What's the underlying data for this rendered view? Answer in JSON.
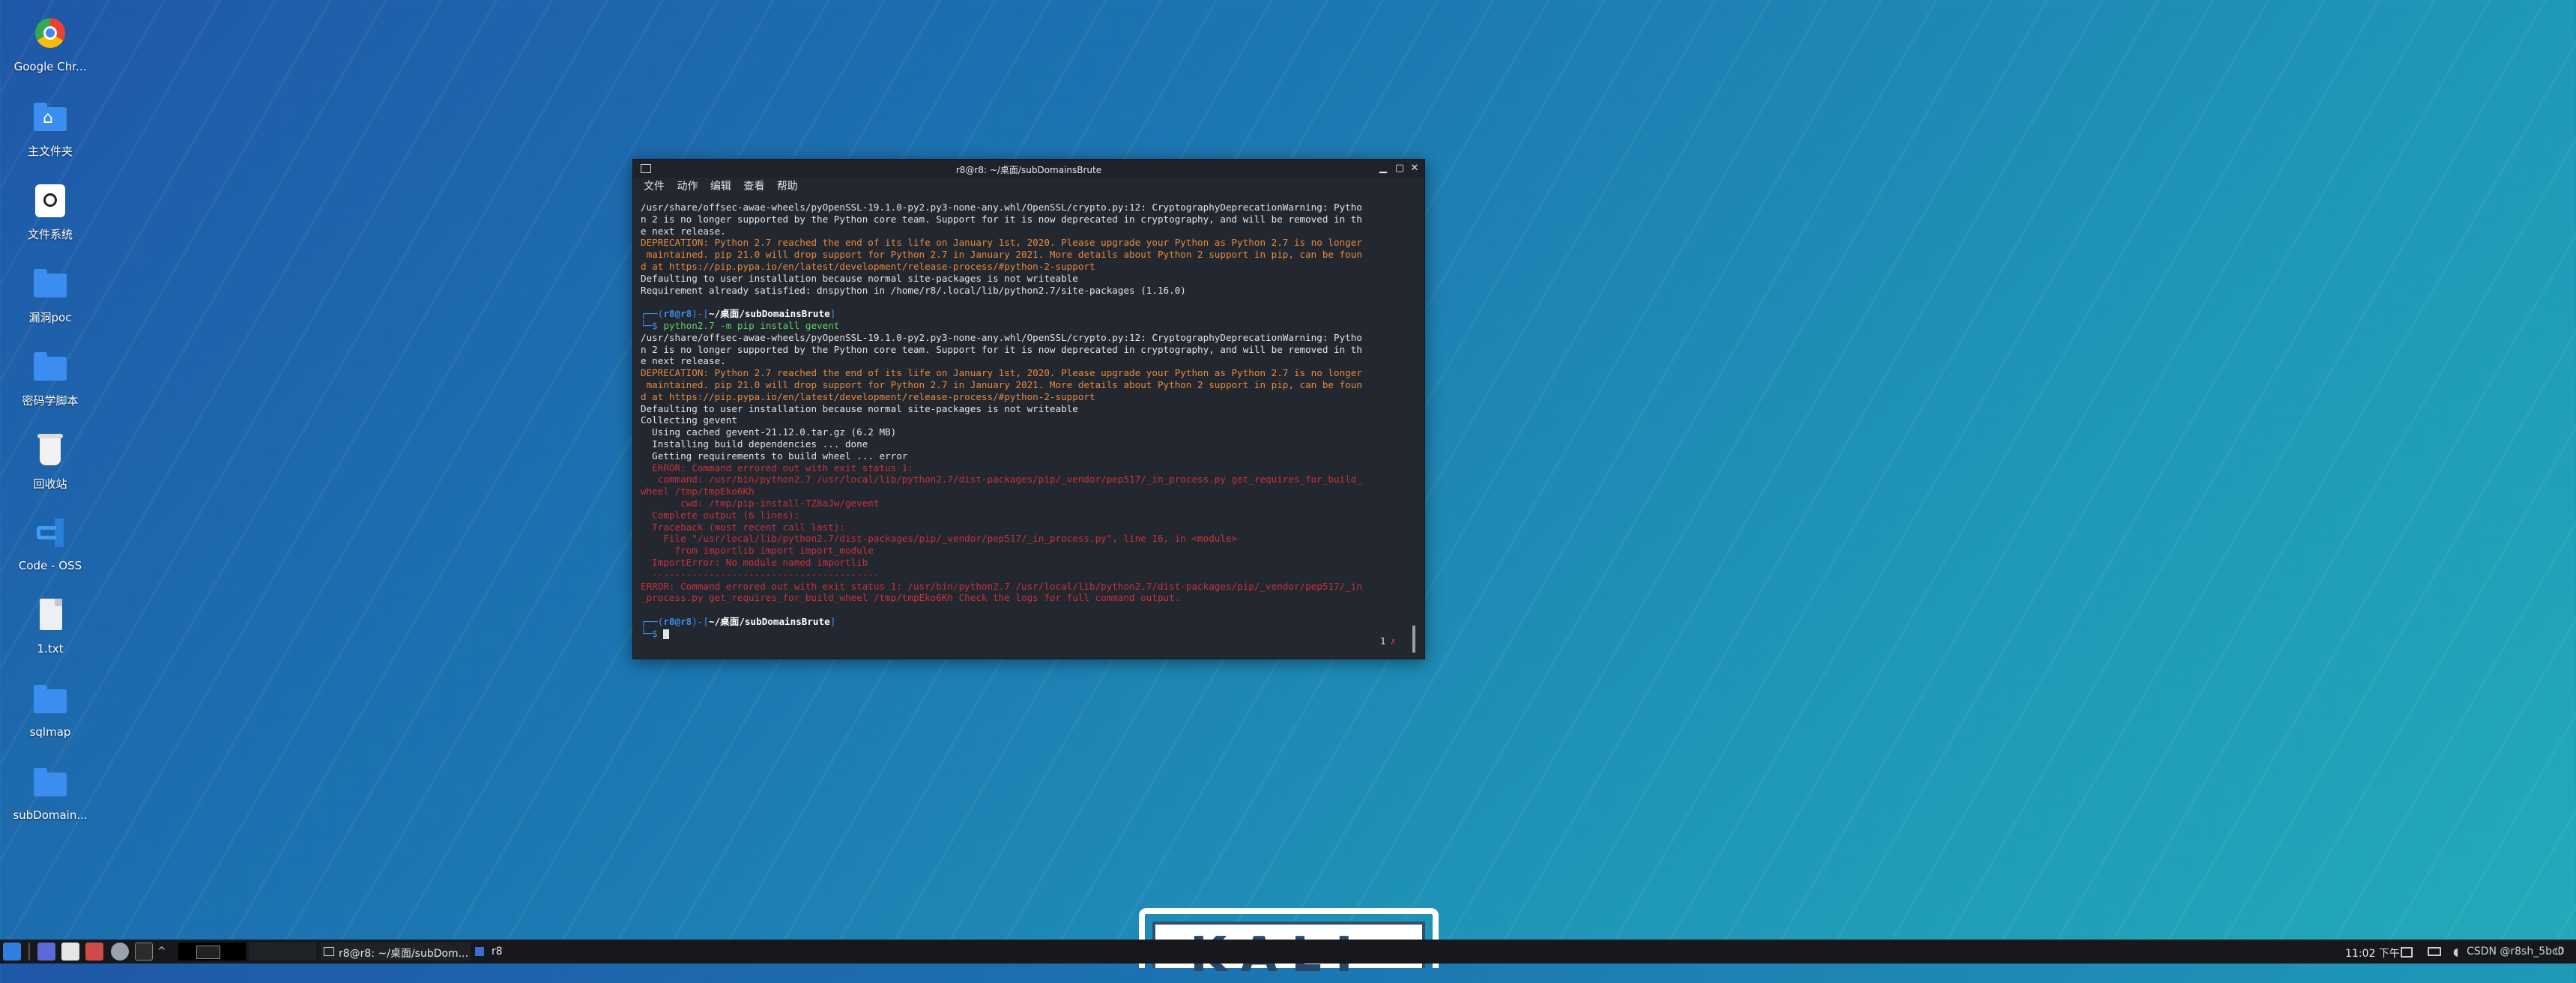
{
  "desktop": {
    "icons": [
      {
        "label": "Google Chr...",
        "icon": "chrome-icon"
      },
      {
        "label": "主文件夹",
        "icon": "home-folder-icon"
      },
      {
        "label": "文件系统",
        "icon": "filesystem-icon"
      },
      {
        "label": "漏洞poc",
        "icon": "folder-icon"
      },
      {
        "label": "密码学脚本",
        "icon": "folder-icon"
      },
      {
        "label": "回收站",
        "icon": "trash-icon"
      },
      {
        "label": "Code - OSS",
        "icon": "code-oss-icon"
      },
      {
        "label": "1.txt",
        "icon": "text-file-icon"
      },
      {
        "label": "sqlmap",
        "icon": "folder-icon"
      },
      {
        "label": "subDomain...",
        "icon": "folder-icon"
      }
    ],
    "wallpaper_logo": "KALI"
  },
  "terminal": {
    "title": "r8@r8: ~/桌面/subDomainsBrute",
    "menu": [
      "文件",
      "动作",
      "编辑",
      "查看",
      "帮助"
    ],
    "lines": [
      {
        "s": "/usr/share/offsec-awae-wheels/pyOpenSSL-19.1.0-py2.py3-none-any.whl/OpenSSL/crypto.py:12: CryptographyDeprecationWarning: Pytho",
        "c": "w"
      },
      {
        "s": "n 2 is no longer supported by the Python core team. Support for it is now deprecated in cryptography, and will be removed in th",
        "c": "w"
      },
      {
        "s": "e next release.",
        "c": "w"
      },
      {
        "s": "DEPRECATION: Python 2.7 reached the end of its life on January 1st, 2020. Please upgrade your Python as Python 2.7 is no longer",
        "c": "o"
      },
      {
        "s": " maintained. pip 21.0 will drop support for Python 2.7 in January 2021. More details about Python 2 support in pip, can be foun",
        "c": "o"
      },
      {
        "s": "d at https://pip.pypa.io/en/latest/development/release-process/#python-2-support",
        "c": "o"
      },
      {
        "s": "Defaulting to user installation because normal site-packages is not writeable",
        "c": "w"
      },
      {
        "s": "Requirement already satisfied: dnspython in /home/r8/.local/lib/python2.7/site-packages (1.16.0)",
        "c": "w"
      },
      {
        "s": "",
        "c": "w"
      },
      {
        "prompt": true,
        "user": "r8@r8",
        "path": "~/桌面/subDomainsBrute"
      },
      {
        "cmd": true,
        "s": "python2.7 -m pip install gevent"
      },
      {
        "s": "/usr/share/offsec-awae-wheels/pyOpenSSL-19.1.0-py2.py3-none-any.whl/OpenSSL/crypto.py:12: CryptographyDeprecationWarning: Pytho",
        "c": "w"
      },
      {
        "s": "n 2 is no longer supported by the Python core team. Support for it is now deprecated in cryptography, and will be removed in th",
        "c": "w"
      },
      {
        "s": "e next release.",
        "c": "w"
      },
      {
        "s": "DEPRECATION: Python 2.7 reached the end of its life on January 1st, 2020. Please upgrade your Python as Python 2.7 is no longer",
        "c": "o"
      },
      {
        "s": " maintained. pip 21.0 will drop support for Python 2.7 in January 2021. More details about Python 2 support in pip, can be foun",
        "c": "o"
      },
      {
        "s": "d at https://pip.pypa.io/en/latest/development/release-process/#python-2-support",
        "c": "o"
      },
      {
        "s": "Defaulting to user installation because normal site-packages is not writeable",
        "c": "w"
      },
      {
        "s": "Collecting gevent",
        "c": "w"
      },
      {
        "s": "  Using cached gevent-21.12.0.tar.gz (6.2 MB)",
        "c": "w"
      },
      {
        "s": "  Installing build dependencies ... done",
        "c": "w"
      },
      {
        "s": "  Getting requirements to build wheel ... error",
        "c": "w"
      },
      {
        "s": "  ERROR: Command errored out with exit status 1:",
        "c": "r"
      },
      {
        "s": "   command: /usr/bin/python2.7 /usr/local/lib/python2.7/dist-packages/pip/_vendor/pep517/_in_process.py get_requires_for_build_",
        "c": "r"
      },
      {
        "s": "wheel /tmp/tmpEko6Kh",
        "c": "r"
      },
      {
        "s": "       cwd: /tmp/pip-install-TZ8aJw/gevent",
        "c": "r"
      },
      {
        "s": "  Complete output (6 lines):",
        "c": "r"
      },
      {
        "s": "  Traceback (most recent call last):",
        "c": "r"
      },
      {
        "s": "    File \"/usr/local/lib/python2.7/dist-packages/pip/_vendor/pep517/_in_process.py\", line 16, in <module>",
        "c": "r"
      },
      {
        "s": "      from importlib import import_module",
        "c": "r"
      },
      {
        "s": "  ImportError: No module named importlib",
        "c": "r"
      },
      {
        "s": "  ----------------------------------------",
        "c": "r"
      },
      {
        "s": "ERROR: Command errored out with exit status 1: /usr/bin/python2.7 /usr/local/lib/python2.7/dist-packages/pip/_vendor/pep517/_in",
        "c": "r"
      },
      {
        "s": "_process.py get_requires_for_build_wheel /tmp/tmpEko6Kh Check the logs for full command output.",
        "c": "r"
      },
      {
        "s": "",
        "c": "w"
      },
      {
        "prompt": true,
        "user": "r8@r8",
        "path": "~/桌面/subDomainsBrute"
      },
      {
        "cursor": true
      }
    ],
    "exit_status": "1",
    "exit_mark": "✗"
  },
  "taskbar": {
    "window_label": "r8@r8: ~/桌面/subDom...",
    "window_label2": "r8",
    "clock": "11:02 下午",
    "tray_text": "CSDN @r8sh_5bc0"
  }
}
